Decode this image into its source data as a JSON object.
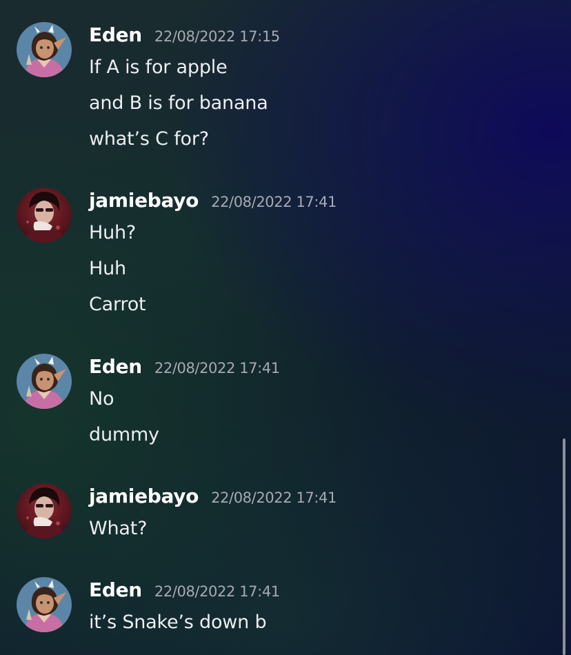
{
  "messages": [
    {
      "author": "Eden",
      "timestamp": "22/08/2022 17:15",
      "avatar": "eden-avatar",
      "lines": [
        "If A is for apple",
        "and B is for banana",
        "what’s C for?"
      ]
    },
    {
      "author": "jamiebayo",
      "timestamp": "22/08/2022 17:41",
      "avatar": "jamiebayo-avatar",
      "lines": [
        "Huh?",
        "Huh",
        "Carrot"
      ]
    },
    {
      "author": "Eden",
      "timestamp": "22/08/2022 17:41",
      "avatar": "eden-avatar",
      "lines": [
        "No",
        "dummy"
      ]
    },
    {
      "author": "jamiebayo",
      "timestamp": "22/08/2022 17:41",
      "avatar": "jamiebayo-avatar",
      "lines": [
        "What?"
      ]
    },
    {
      "author": "Eden",
      "timestamp": "22/08/2022 17:41",
      "avatar": "eden-avatar",
      "lines": [
        "it’s Snake’s down b"
      ]
    }
  ],
  "colors": {
    "username": "#ffffff",
    "timestamp": "#a7aab3",
    "message_text": "#eceef2",
    "scrollbar": "#8d9299"
  }
}
